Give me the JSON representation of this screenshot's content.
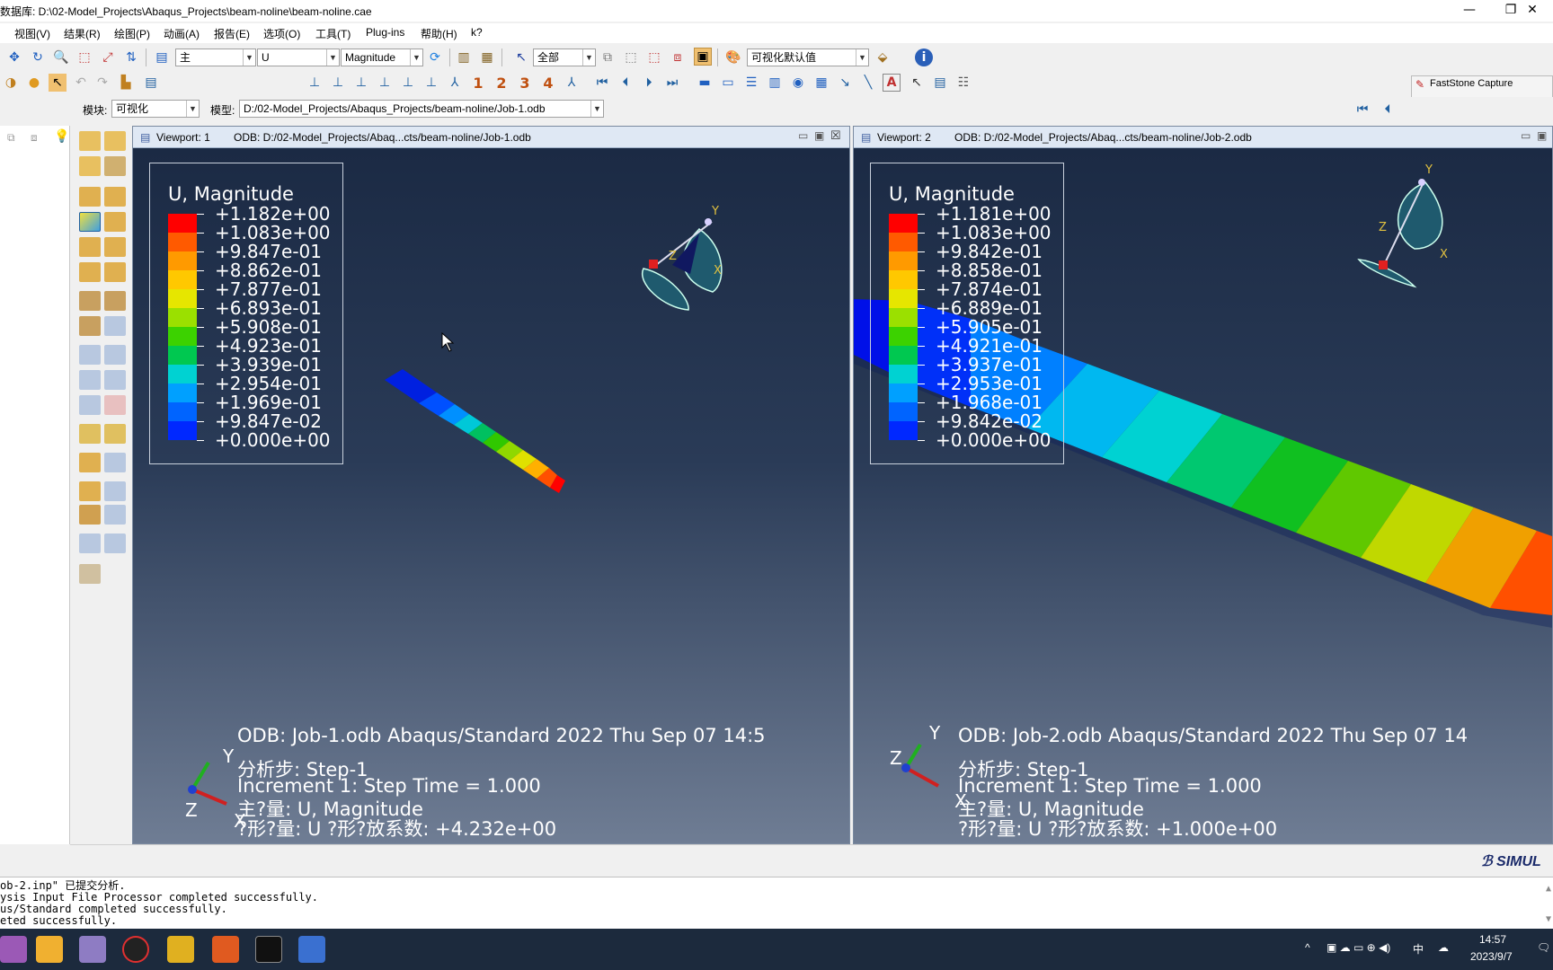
{
  "window": {
    "title": "数据库: D:\\02-Model_Projects\\Abaqus_Projects\\beam-noline\\beam-noline.cae",
    "minimize": "—",
    "maximize": "❐",
    "close": "✕"
  },
  "menu": [
    "视图(V)",
    "结果(R)",
    "绘图(P)",
    "动画(A)",
    "报告(E)",
    "选项(O)",
    "工具(T)",
    "Plug-ins",
    "帮助(H)",
    "k?"
  ],
  "toolbar": {
    "primary_field": "主",
    "variable": "U",
    "component": "Magnitude",
    "select_scope": "全部",
    "render_style": "可视化默认值",
    "frame_numbers": [
      "1",
      "2",
      "3",
      "4"
    ]
  },
  "context": {
    "module_label": "模块:",
    "module_value": "可视化",
    "model_label": "模型:",
    "model_value": "D:/02-Model_Projects/Abaqus_Projects/beam-noline/Job-1.odb"
  },
  "faststone": {
    "title": "FastStone Capture"
  },
  "viewports": [
    {
      "title": "Viewport: 1",
      "odb": "ODB: D:/02-Model_Projects/Abaq...cts/beam-noline/Job-1.odb",
      "legend_title": "U, Magnitude",
      "legend_values": [
        "+1.182e+00",
        "+1.083e+00",
        "+9.847e-01",
        "+8.862e-01",
        "+7.877e-01",
        "+6.893e-01",
        "+5.908e-01",
        "+4.923e-01",
        "+3.939e-01",
        "+2.954e-01",
        "+1.969e-01",
        "+9.847e-02",
        "+0.000e+00"
      ],
      "info_line1": "ODB: Job-1.odb    Abaqus/Standard 2022    Thu Sep 07 14:5",
      "info_step": "分析步: Step-1",
      "info_increment": "Increment      1: Step Time =     1.000",
      "info_primary": "主?量: U, Magnitude",
      "info_deformed": "?形?量: U   ?形?放系数: +4.232e+00",
      "triad": {
        "y": "Y",
        "z": "Z",
        "x": "X"
      }
    },
    {
      "title": "Viewport: 2",
      "odb": "ODB: D:/02-Model_Projects/Abaq...cts/beam-noline/Job-2.odb",
      "legend_title": "U, Magnitude",
      "legend_values": [
        "+1.181e+00",
        "+1.083e+00",
        "+9.842e-01",
        "+8.858e-01",
        "+7.874e-01",
        "+6.889e-01",
        "+5.905e-01",
        "+4.921e-01",
        "+3.937e-01",
        "+2.953e-01",
        "+1.968e-01",
        "+9.842e-02",
        "+0.000e+00"
      ],
      "info_line1": "ODB: Job-2.odb    Abaqus/Standard 2022    Thu Sep 07 14",
      "info_step": "分析步: Step-1",
      "info_increment": "Increment      1: Step Time =     1.000",
      "info_primary": "主?量: U, Magnitude",
      "info_deformed": "?形?量: U   ?形?放系数: +1.000e+00",
      "triad": {
        "y": "Y",
        "z": "Z",
        "x": "X"
      }
    }
  ],
  "legend_colors": [
    "#ff0000",
    "#ff5a00",
    "#ff9a00",
    "#ffc800",
    "#e6e600",
    "#9be000",
    "#3cd200",
    "#00c850",
    "#00d2d2",
    "#00a0ff",
    "#0064ff",
    "#0028ff",
    "#0000ff"
  ],
  "branding": "SIMUL",
  "console_lines": [
    "ob-2.inp\" 已提交分析.",
    "ysis Input File Processor completed successfully.",
    "us/Standard completed successfully.",
    "eted successfully."
  ],
  "taskbar": {
    "time": "14:57",
    "date": "2023/9/7",
    "ime": "中"
  }
}
